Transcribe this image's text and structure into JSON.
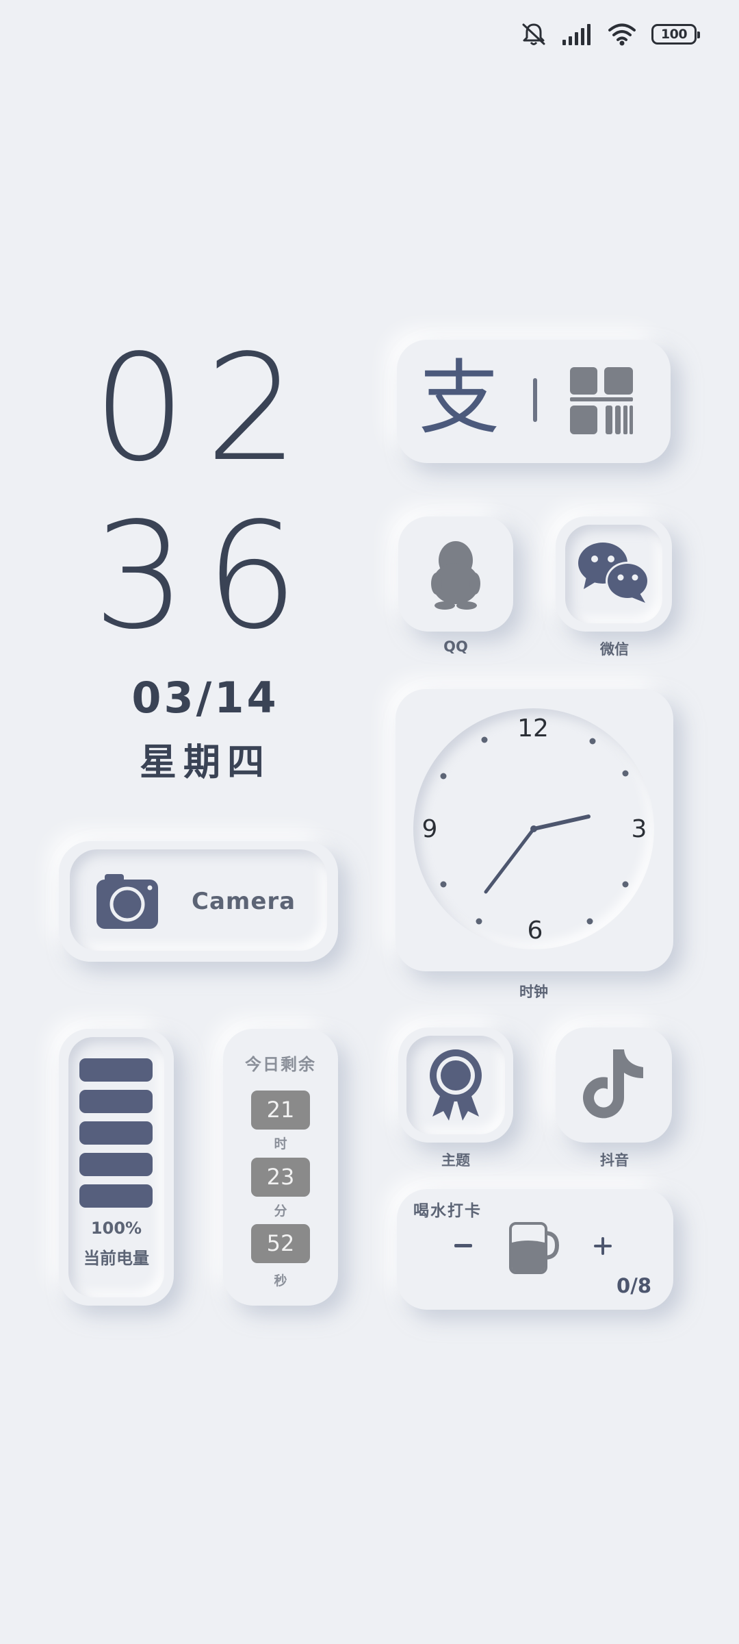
{
  "status_bar": {
    "battery_level": "100",
    "icons": [
      "mute-bell-icon",
      "signal-icon",
      "wifi-icon",
      "battery-icon"
    ]
  },
  "clock": {
    "hour": "02",
    "minute": "36",
    "date": "03/14",
    "weekday": "星期四"
  },
  "apps": {
    "alipay": {
      "char": "支"
    },
    "qq": {
      "label": "QQ"
    },
    "wechat": {
      "label": "微信"
    },
    "camera": {
      "label": "Camera"
    },
    "theme": {
      "label": "主题"
    },
    "douyin": {
      "label": "抖音"
    }
  },
  "analog_clock": {
    "label": "时钟",
    "numerals": {
      "top": "12",
      "right": "3",
      "bottom": "6",
      "left": "9"
    }
  },
  "battery_widget": {
    "percent": "100%",
    "label": "当前电量",
    "level": 1.0
  },
  "countdown": {
    "title": "今日剩余",
    "hours": "21",
    "hours_unit": "时",
    "minutes": "23",
    "minutes_unit": "分",
    "seconds": "52",
    "seconds_unit": "秒"
  },
  "water": {
    "title": "喝水打卡",
    "count": "0/8"
  },
  "colors": {
    "background": "#eef0f4",
    "text_dark": "#3a4355",
    "accent": "#565f7d",
    "gray_box": "#8a8a8a"
  }
}
